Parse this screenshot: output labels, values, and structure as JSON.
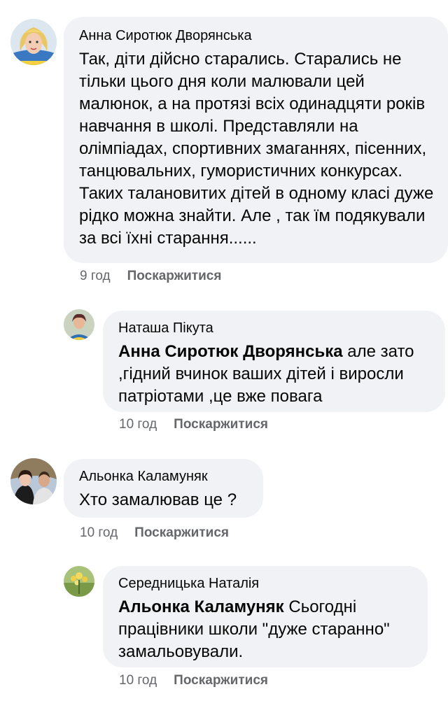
{
  "comments": [
    {
      "author": "Анна Сиротюк Дворянська",
      "mention": "",
      "text": "Так, діти дійсно старались. Старались не тільки цього дня коли малювали цей малюнок, а на протязі всіх одинадцяти років навчання в школі. Представляли на олімпіадах, спортивних змаганнях, пісенних, танцювальних, гумористичних конкурсах. Таких талановитих дітей в одному класі дуже рідко можна знайти. Але , так їм подякували за всі їхні старання......",
      "time": "9 год",
      "report": "Поскаржитися"
    },
    {
      "author": "Наташа Пікута",
      "mention": "Анна Сиротюк Дворянська",
      "text": " але зато ,гідний вчинок ваших дітей і виросли патріотами ,це вже повага",
      "time": "10 год",
      "report": "Поскаржитися"
    },
    {
      "author": "Альонка Каламуняк",
      "mention": "",
      "text": "Хто замалював це ?",
      "time": "10 год",
      "report": "Поскаржитися"
    },
    {
      "author": "Середницька Наталія",
      "mention": "Альонка Каламуняк",
      "text": " Сьогодні працівники школи \"дуже старанно\" замальовували.",
      "time": "10 год",
      "report": "Поскаржитися"
    }
  ]
}
